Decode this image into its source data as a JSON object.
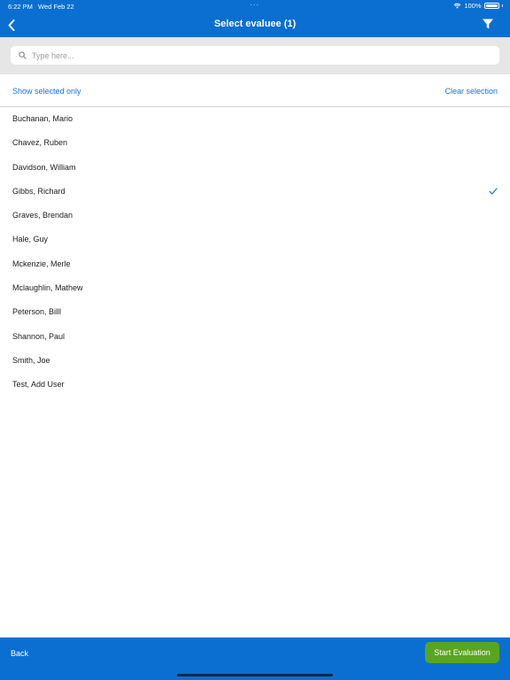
{
  "status_bar": {
    "time": "6:22 PM",
    "date": "Wed Feb 22",
    "dots": "···",
    "battery": "100%"
  },
  "header": {
    "title": "Select evaluee (1)",
    "back_icon": "chevron-left-icon",
    "filter_icon": "filter-icon"
  },
  "search": {
    "placeholder": "Type here...",
    "value": ""
  },
  "actions": {
    "show_selected": "Show selected only",
    "clear_selection": "Clear selection"
  },
  "evaluees": [
    {
      "name": "Buchanan, Mario",
      "selected": false
    },
    {
      "name": "Chavez, Ruben",
      "selected": false
    },
    {
      "name": "Davidson, William",
      "selected": false
    },
    {
      "name": "Gibbs, Richard",
      "selected": true
    },
    {
      "name": "Graves, Brendan",
      "selected": false
    },
    {
      "name": "Hale, Guy",
      "selected": false
    },
    {
      "name": "Mckenzie, Merle",
      "selected": false
    },
    {
      "name": "Mclaughlin, Mathew",
      "selected": false
    },
    {
      "name": "Peterson, Billl",
      "selected": false
    },
    {
      "name": "Shannon, Paul",
      "selected": false
    },
    {
      "name": "Smith, Joe",
      "selected": false
    },
    {
      "name": "Test, Add User",
      "selected": false
    }
  ],
  "footer": {
    "back_label": "Back",
    "start_label": "Start Evaluation"
  },
  "colors": {
    "brand_blue": "#0a6fd1",
    "link_blue": "#1a73d9",
    "start_green": "#5aa51d"
  }
}
